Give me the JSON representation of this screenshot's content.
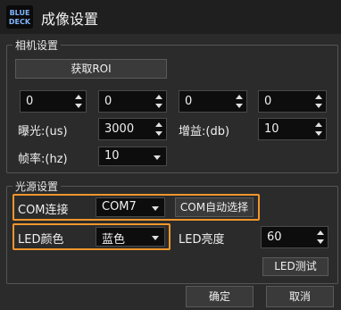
{
  "window": {
    "title": "成像设置"
  },
  "camera": {
    "title": "相机设置",
    "roi_button": "获取ROI",
    "roi_values": [
      "0",
      "0",
      "0",
      "0"
    ],
    "exposure_label": "曝光:(us)",
    "exposure_value": "3000",
    "gain_label": "增益:(db)",
    "gain_value": "10",
    "framerate_label": "帧率:(hz)",
    "framerate_value": "10"
  },
  "light": {
    "title": "光源设置",
    "com_label": "COM连接",
    "com_value": "COM7",
    "com_auto_button": "COM自动选择",
    "led_color_label": "LED颜色",
    "led_color_value": "蓝色",
    "led_brightness_label": "LED亮度",
    "led_brightness_value": "60",
    "led_test_button": "LED测试"
  },
  "footer": {
    "ok": "确定",
    "cancel": "取消"
  },
  "colors": {
    "highlight": "#f0962b",
    "background": "#2b2b2b",
    "input_bg": "#0d0d0d"
  },
  "icons": {
    "logo": "blue-deck-logo"
  }
}
